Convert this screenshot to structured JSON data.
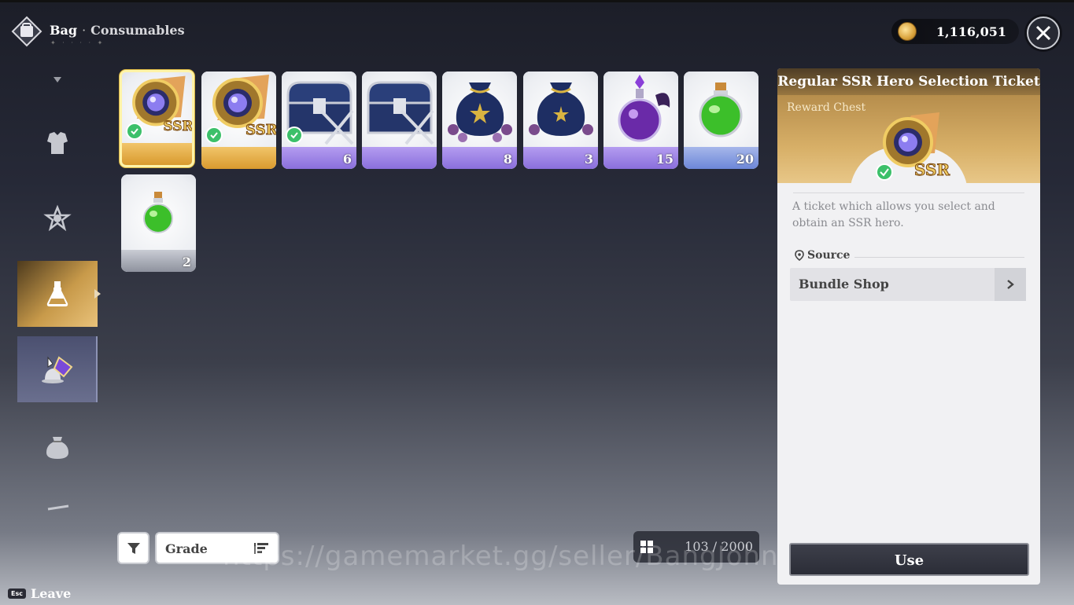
{
  "header": {
    "title": "Bag",
    "separator": "·",
    "section": "Consumables",
    "decoration": "✦ · · · · ✦"
  },
  "currency": {
    "icon": "gold-coin-icon",
    "amount": "1,116,051"
  },
  "sidebar": {
    "items": [
      {
        "icon": "arrow-down-icon"
      },
      {
        "icon": "armor-icon"
      },
      {
        "icon": "gem-pouch-icon"
      },
      {
        "icon": "potion-flask-icon",
        "active": true
      },
      {
        "icon": "crystal-shard-icon"
      },
      {
        "icon": "bag-icon"
      },
      {
        "icon": "sword-icon"
      }
    ]
  },
  "items": [
    {
      "name": "SSR Hero Selection Ticket",
      "count": "",
      "grade": "gold",
      "checked": true,
      "selected": true
    },
    {
      "name": "SSR Hero Selection Ticket",
      "count": "",
      "grade": "gold",
      "checked": true
    },
    {
      "name": "Reward Chest",
      "count": "6",
      "grade": "purple",
      "checked": true
    },
    {
      "name": "Reward Chest",
      "count": "",
      "grade": "purple"
    },
    {
      "name": "Pouch",
      "count": "8",
      "grade": "purple"
    },
    {
      "name": "Pouch",
      "count": "3",
      "grade": "purple"
    },
    {
      "name": "Purple Potion",
      "count": "15",
      "grade": "purple"
    },
    {
      "name": "Green Potion",
      "count": "20",
      "grade": "blue"
    },
    {
      "name": "Small Green Potion",
      "count": "2",
      "grade": "gray"
    }
  ],
  "controls": {
    "sort_label": "Grade",
    "capacity": "103 / 2000"
  },
  "footer": {
    "esc_key": "Esc",
    "leave_label": "Leave"
  },
  "watermark": "https://gamemarket.gg/seller/BangJohn",
  "detail": {
    "title": "Regular SSR Hero Selection Ticket",
    "subtitle": "Reward Chest",
    "badge": "SSR",
    "description": "A ticket which allows you select and obtain an SSR hero.",
    "source_heading": "Source",
    "source_name": "Bundle Shop",
    "use_label": "Use"
  },
  "colors": {
    "gold_band": "#d99a2e",
    "purple_band": "#8a6fdc",
    "blue_band": "#6d87d8",
    "check_green": "#3cc06a"
  }
}
